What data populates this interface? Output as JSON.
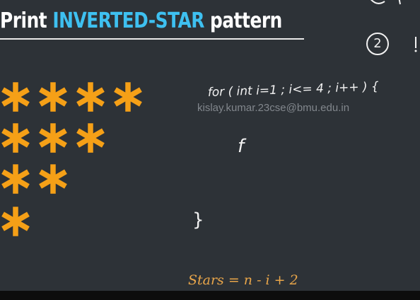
{
  "slide": {
    "title_prefix": "Print ",
    "title_highlight": "INVERTED-STAR",
    "title_suffix": " pattern",
    "highlight_color": "#3ec0f0",
    "star_color": "#f5a017",
    "background_color": "#2d3237"
  },
  "pattern": {
    "rows": [
      4,
      3,
      2,
      1
    ]
  },
  "whiteboard": {
    "loop_code": "for ( int i=1 ; i<= 4 ; i++ ) {",
    "inner_mark": "f",
    "closing_brace": "}",
    "circle_number": "2",
    "formula": "Stars = n - i + 2"
  },
  "watermark": {
    "text": "kislay.kumar.23cse@bmu.edu.in"
  }
}
